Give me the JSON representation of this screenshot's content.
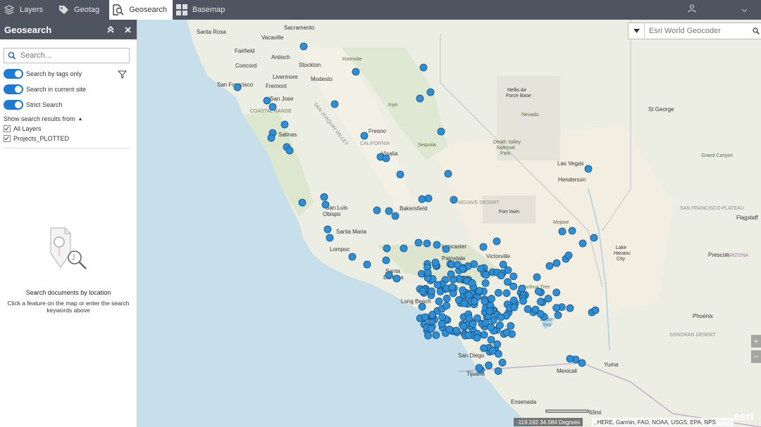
{
  "topbar": {
    "tabs": [
      {
        "label": "Layers",
        "icon": "layers-icon"
      },
      {
        "label": "Geotag",
        "icon": "tag-icon"
      },
      {
        "label": "Geosearch",
        "icon": "geosearch-icon",
        "active": true
      },
      {
        "label": "Basemap",
        "icon": "basemap-grid-icon"
      }
    ],
    "user_icon": "user-icon",
    "user_menu_icon": "chevron-down-icon"
  },
  "panel": {
    "title": "Geosearch",
    "search_placeholder": "Search...",
    "toggles": [
      {
        "label": "Search by tags only",
        "on": true
      },
      {
        "label": "Search in current site",
        "on": true
      },
      {
        "label": "Strict Search",
        "on": true
      }
    ],
    "show_from_label": "Show search results from",
    "layers": [
      {
        "label": "All Layers",
        "checked": true
      },
      {
        "label": "Projects_PLOTTED",
        "checked": true
      }
    ],
    "empty_title": "Search documents by location",
    "empty_desc_line1": "Click a feature on the map or enter the search",
    "empty_desc_line2": "keywords above"
  },
  "geocoder": {
    "placeholder": "Esri World Geocoder"
  },
  "map": {
    "zoom_in": "+",
    "zoom_out": "−",
    "coordinates": "-119.192 34.584 Degrees",
    "attribution": ", HERE, Garmin, FAO, NOAA, USGS, EPA, NPS",
    "scale_label": "60mi",
    "logo": "esri",
    "accent_color": "#2d8fd6",
    "labels": {
      "santa_rosa": "Santa Rosa",
      "sacramento": "Sacramento",
      "vacaville": "Vacaville",
      "fairfield": "Fairfield",
      "antioch": "Antioch",
      "concord": "Concord",
      "stockton": "Stockton",
      "livermore": "Livermore",
      "modesto": "Modesto",
      "san_francisco": "San Francisco",
      "fremont": "Fremont",
      "san_jose": "San Jose",
      "coastal_range": "COASTAL RANGE",
      "salinas": "Salinas",
      "fresno": "Fresno",
      "california": "CALIFORNIA",
      "visalia": "Visalia",
      "bakersfield": "Bakersfield",
      "san_luis_obispo_1": "San Luis",
      "san_luis_obispo_2": "Obispo",
      "santa_maria": "Santa Maria",
      "lompoc": "Lompoc",
      "santa_barbara_1": "Santa",
      "santa_barbara_2": "Barbara",
      "lancaster": "Lancaster",
      "palmdale": "Palmdale",
      "victorville": "Victorville",
      "long_beach": "Long Beach",
      "san_diego": "San Diego",
      "tijuana": "Tijuana",
      "ensenada": "Ensenada",
      "mexicali": "Mexicali",
      "yuma": "Yuma",
      "las_vegas": "Las Vegas",
      "henderson": "Henderson",
      "mojave_desert": "MOJAVE DESERT",
      "fort_irwin": "Fort Irwin",
      "lake_havasu_1": "Lake",
      "lake_havasu_2": "Havasu",
      "lake_havasu_3": "City",
      "prescott": "Prescott",
      "phoenix": "Phoenix",
      "flagstaff": "Flagstaff",
      "st_george": "St George",
      "sonoran_desert": "SONORAN DESERT",
      "san_francisco_plateau": "SAN FRANCISCO PLATEAU",
      "arizona": "ARIZONA",
      "salton_sea_1": "Salton",
      "salton_sea_2": "Sea",
      "san_joaquin_valley": "SAN JOAQUIN VALLEY",
      "death_valley_1": "Death Valley",
      "death_valley_2": "National",
      "death_valley_3": "Park",
      "nellis_1": "Nellis Air",
      "nellis_2": "Force Base",
      "nevada_nat_1": "Nevada",
      "mojave_nat": "Mojave",
      "joshua_tree": "Joshua Tree",
      "yosemite": "Yosemite",
      "sequoia": "Sequoia",
      "inyo": "Inyo",
      "grand_canyon": "Grand Canyon"
    }
  }
}
